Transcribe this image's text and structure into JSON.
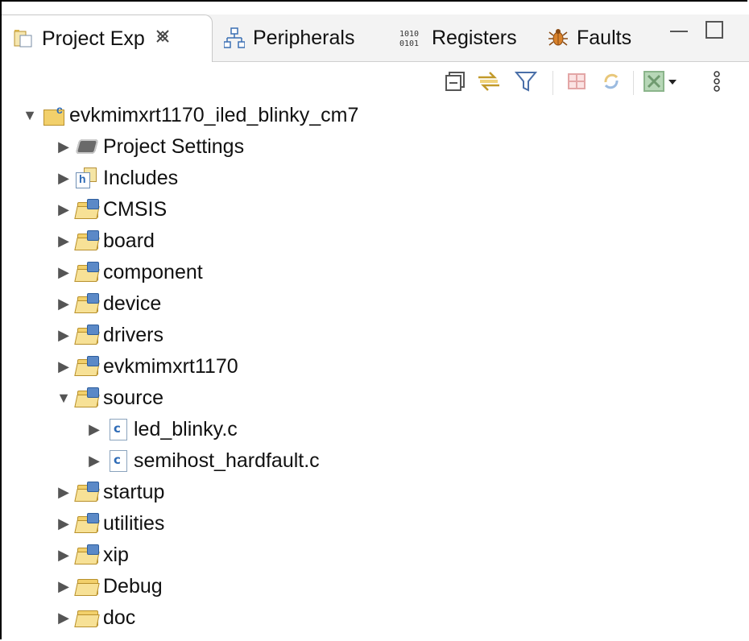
{
  "tabs": [
    {
      "label": "Project Exp",
      "active": true,
      "icon": "project-explorer-icon"
    },
    {
      "label": "Peripherals",
      "icon": "peripherals-icon"
    },
    {
      "label": "Registers",
      "icon": "registers-icon"
    },
    {
      "label": "Faults",
      "icon": "faults-bug-icon"
    }
  ],
  "tab_icon_glyphs": {
    "registers": "1010\n0101"
  },
  "toolbar": {
    "buttons": [
      "collapse-all-icon",
      "link-with-editor-icon",
      "filter-icon",
      "add-watch-icon",
      "refresh-icon",
      "close-view-menu-icon",
      "view-menu-icon"
    ]
  },
  "tree": {
    "project": {
      "label": "evkmimxrt1170_iled_blinky_cm7",
      "expanded": true
    },
    "items": [
      {
        "label": "Project Settings",
        "icon": "chip-icon"
      },
      {
        "label": "Includes",
        "icon": "includes-icon"
      },
      {
        "label": "CMSIS",
        "icon": "source-folder-icon"
      },
      {
        "label": "board",
        "icon": "source-folder-icon"
      },
      {
        "label": "component",
        "icon": "source-folder-icon"
      },
      {
        "label": "device",
        "icon": "source-folder-icon"
      },
      {
        "label": "drivers",
        "icon": "source-folder-icon"
      },
      {
        "label": "evkmimxrt1170",
        "icon": "source-folder-icon"
      },
      {
        "label": "source",
        "icon": "source-folder-icon",
        "expanded": true
      },
      {
        "label": "led_blinky.c",
        "icon": "c-file-icon",
        "level": 2
      },
      {
        "label": "semihost_hardfault.c",
        "icon": "c-file-icon",
        "level": 2
      },
      {
        "label": "startup",
        "icon": "source-folder-icon"
      },
      {
        "label": "utilities",
        "icon": "source-folder-icon"
      },
      {
        "label": "xip",
        "icon": "source-folder-icon"
      },
      {
        "label": "Debug",
        "icon": "folder-icon"
      },
      {
        "label": "doc",
        "icon": "folder-icon"
      }
    ]
  },
  "colors": {
    "folder": "#f2d06b",
    "badge": "#5b89c7",
    "accent": "#2e6bb6"
  }
}
